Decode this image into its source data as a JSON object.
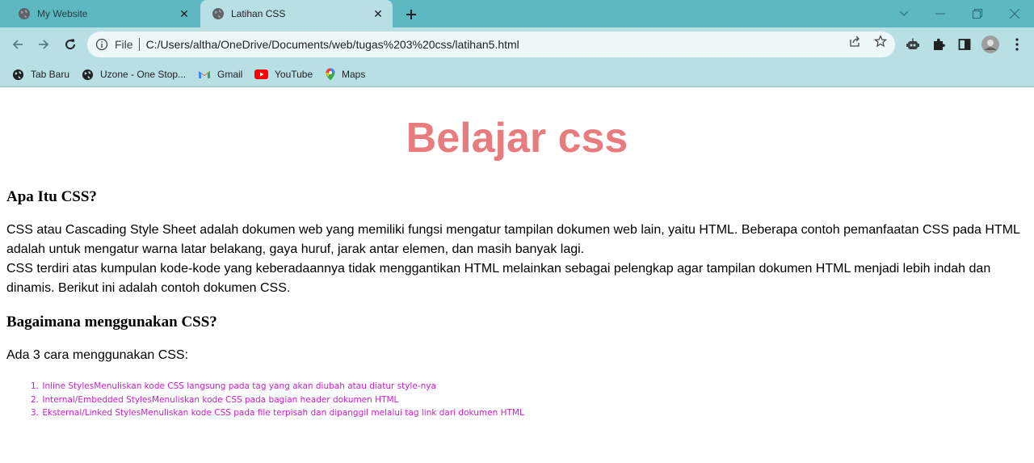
{
  "browser": {
    "tabs": [
      {
        "title": "My Website",
        "active": false
      },
      {
        "title": "Latihan CSS",
        "active": true
      }
    ],
    "address": {
      "scheme_label": "File",
      "url": "C:/Users/altha/OneDrive/Documents/web/tugas%203%20css/latihan5.html"
    },
    "bookmarks": [
      {
        "label": "Tab Baru",
        "icon": "globe-icon"
      },
      {
        "label": "Uzone - One Stop...",
        "icon": "globe-icon"
      },
      {
        "label": "Gmail",
        "icon": "gmail-icon"
      },
      {
        "label": "YouTube",
        "icon": "youtube-icon"
      },
      {
        "label": "Maps",
        "icon": "maps-icon"
      }
    ],
    "colors": {
      "tab_strip": "#5db8c1",
      "toolbar": "#b8e0e4"
    }
  },
  "page": {
    "heading": "Belajar css",
    "heading_color": "#e77b7e",
    "section1": {
      "title": "Apa Itu CSS?",
      "paragraph_1": "CSS atau Cascading Style Sheet adalah dokumen web yang memiliki fungsi mengatur tampilan dokumen web lain, yaitu HTML. Beberapa contoh pemanfaatan CSS pada HTML adalah untuk mengatur warna latar belakang, gaya huruf, jarak antar elemen, dan masih banyak lagi.",
      "paragraph_2": "CSS terdiri atas kumpulan kode-kode yang keberadaannya tidak menggantikan HTML melainkan sebagai pelengkap agar tampilan dokumen HTML menjadi lebih indah dan dinamis. Berikut ini adalah contoh dokumen CSS."
    },
    "section2": {
      "title": "Bagaimana menggunakan CSS?",
      "intro": "Ada 3 cara menggunakan CSS:",
      "list_color": "#d11ad1",
      "items": [
        {
          "num": "1.",
          "text": "Inline StylesMenuliskan kode CSS langsung pada tag yang akan diubah atau diatur style-nya"
        },
        {
          "num": "2.",
          "text": "Internal/Embedded StylesMenuliskan kode CSS pada bagian header dokumen HTML"
        },
        {
          "num": "3.",
          "text": "Eksternal/Linked StylesMenuliskan kode CSS pada file terpisah dan dipanggil melalui tag link dari dokumen HTML"
        }
      ]
    }
  }
}
